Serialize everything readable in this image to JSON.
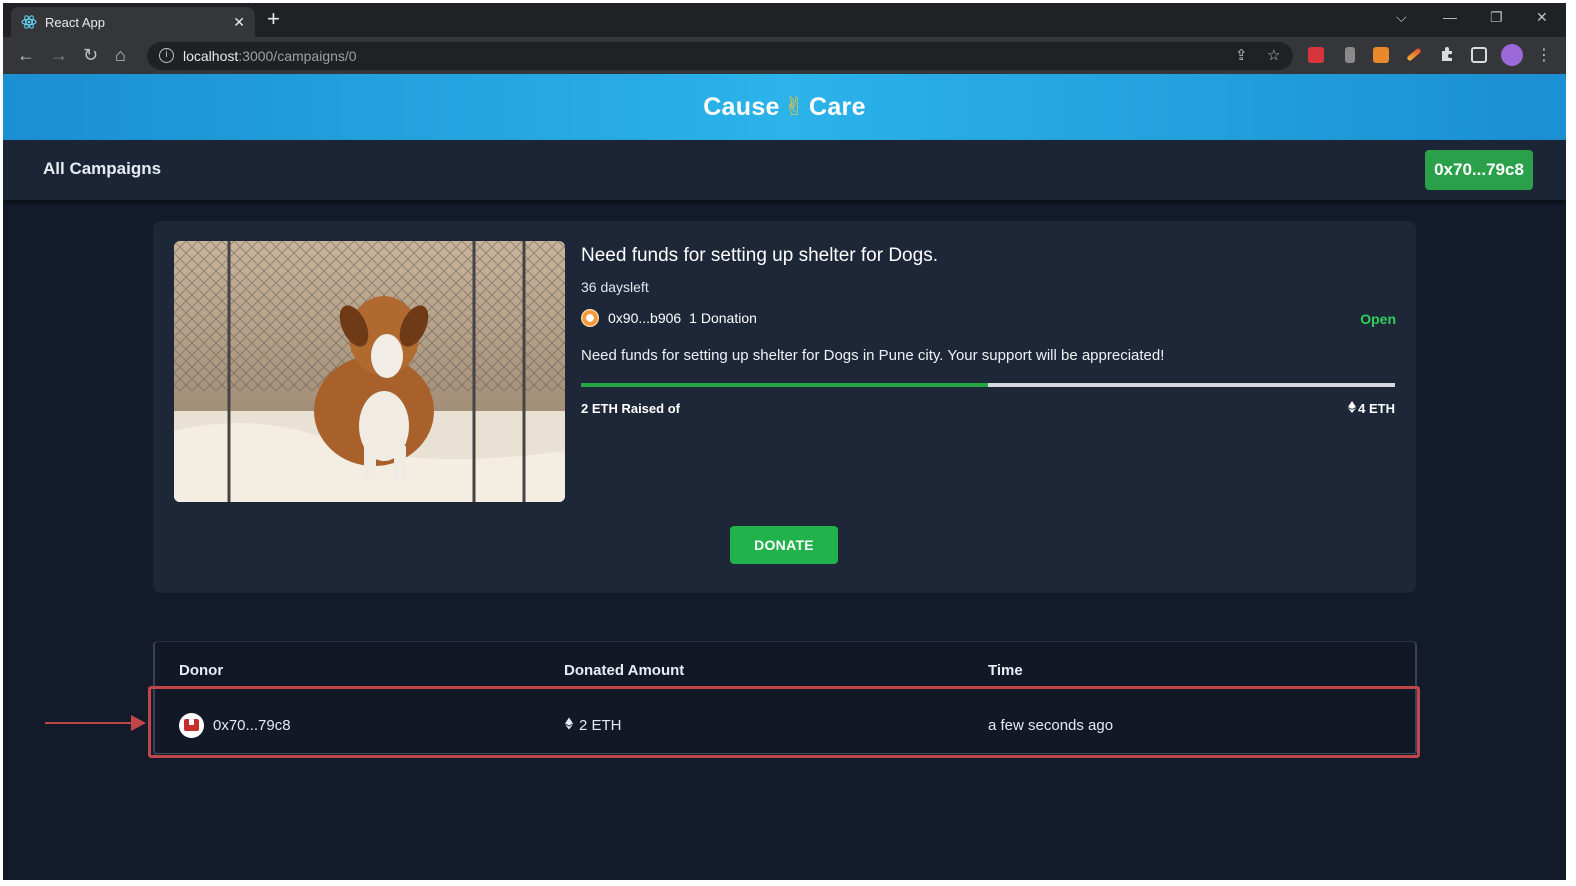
{
  "browser": {
    "tab_title": "React App",
    "tab_close": "✕",
    "new_tab": "+",
    "url_host": "localhost",
    "url_path": ":3000/campaigns/0"
  },
  "app": {
    "brand_left": "Cause",
    "brand_emoji": "✌",
    "brand_right": "Care",
    "nav_all_campaigns": "All Campaigns",
    "wallet_address": "0x70...79c8"
  },
  "campaign": {
    "title": "Need funds for setting up shelter for Dogs.",
    "days_left": "36 daysleft",
    "owner": "0x90...b906",
    "donation_count": "1 Donation",
    "status": "Open",
    "description": "Need funds for setting up shelter for Dogs in Pune city. Your support will be appreciated!",
    "raised_text": "2 ETH Raised of",
    "goal_text": "4 ETH",
    "progress_fraction": 0.5,
    "donate_label": "DONATE"
  },
  "donations_table": {
    "headers": [
      "Donor",
      "Donated Amount",
      "Time"
    ],
    "rows": [
      {
        "donor": "0x70...79c8",
        "amount": "2 ETH",
        "time": "a few seconds ago"
      }
    ]
  },
  "colors": {
    "accent_green": "#21b24c",
    "hero_blue": "#2bb3ea",
    "annotation_red": "#c0464a"
  },
  "icons": [
    "react-favicon",
    "back-arrow-icon",
    "forward-arrow-icon",
    "reload-icon",
    "home-icon",
    "info-icon",
    "share-icon",
    "star-icon",
    "extensions-icon",
    "ethereum-icon"
  ]
}
